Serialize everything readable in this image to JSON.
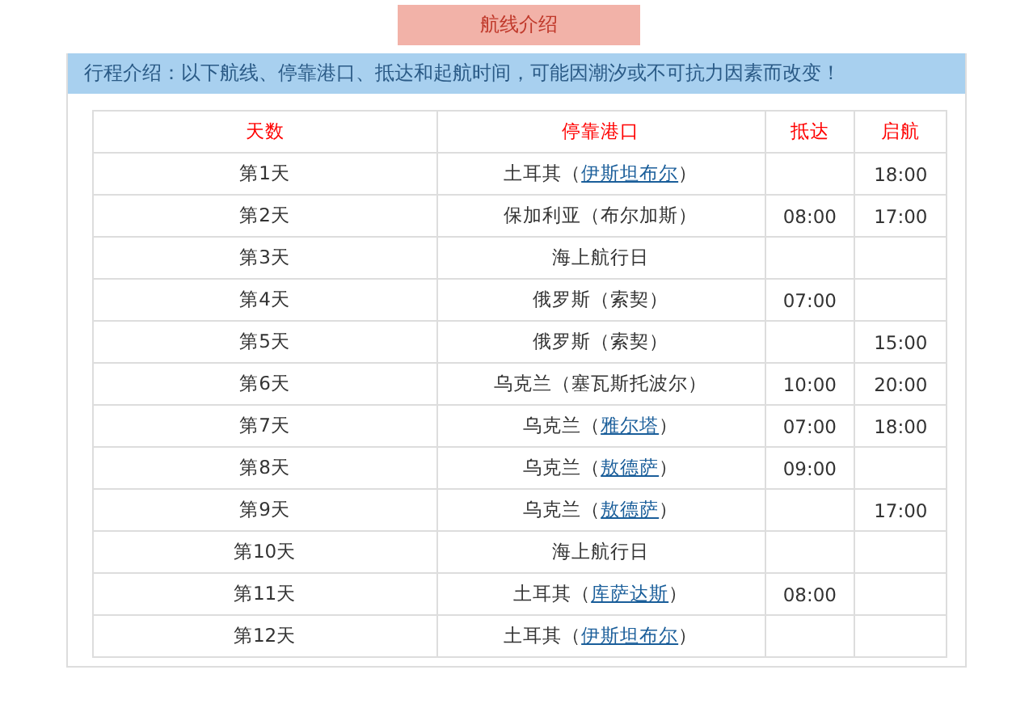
{
  "title": "航线介绍",
  "notice": "行程介绍：以下航线、停靠港口、抵达和起航时间，可能因潮汐或不可抗力因素而改变！",
  "table": {
    "columns": [
      "天数",
      "停靠港口",
      "抵达",
      "启航"
    ],
    "rows": [
      {
        "day": "第1天",
        "port": [
          {
            "text": "土耳其（"
          },
          {
            "text": "伊斯坦布尔",
            "link": true
          },
          {
            "text": "）"
          }
        ],
        "arrive": "",
        "depart": "18:00"
      },
      {
        "day": "第2天",
        "port": [
          {
            "text": "保加利亚（布尔加斯）"
          }
        ],
        "arrive": "08:00",
        "depart": "17:00"
      },
      {
        "day": "第3天",
        "port": [
          {
            "text": "海上航行日"
          }
        ],
        "arrive": "",
        "depart": ""
      },
      {
        "day": "第4天",
        "port": [
          {
            "text": "俄罗斯（索契）"
          }
        ],
        "arrive": "07:00",
        "depart": ""
      },
      {
        "day": "第5天",
        "port": [
          {
            "text": "俄罗斯（索契）"
          }
        ],
        "arrive": "",
        "depart": "15:00"
      },
      {
        "day": "第6天",
        "port": [
          {
            "text": "乌克兰（塞瓦斯托波尔）"
          }
        ],
        "arrive": "10:00",
        "depart": "20:00"
      },
      {
        "day": "第7天",
        "port": [
          {
            "text": "乌克兰（"
          },
          {
            "text": "雅尔塔",
            "link": true
          },
          {
            "text": "）"
          }
        ],
        "arrive": "07:00",
        "depart": "18:00"
      },
      {
        "day": "第8天",
        "port": [
          {
            "text": "乌克兰（"
          },
          {
            "text": "敖德萨",
            "link": true
          },
          {
            "text": "）"
          }
        ],
        "arrive": "09:00",
        "depart": ""
      },
      {
        "day": "第9天",
        "port": [
          {
            "text": "乌克兰（"
          },
          {
            "text": "敖德萨",
            "link": true
          },
          {
            "text": "）"
          }
        ],
        "arrive": "",
        "depart": "17:00"
      },
      {
        "day": "第10天",
        "port": [
          {
            "text": "海上航行日"
          }
        ],
        "arrive": "",
        "depart": ""
      },
      {
        "day": "第11天",
        "port": [
          {
            "text": "土耳其（"
          },
          {
            "text": "库萨达斯",
            "link": true
          },
          {
            "text": "）"
          }
        ],
        "arrive": "08:00",
        "depart": ""
      },
      {
        "day": "第12天",
        "port": [
          {
            "text": "土耳其（"
          },
          {
            "text": "伊斯坦布尔",
            "link": true
          },
          {
            "text": "）"
          }
        ],
        "arrive": "",
        "depart": ""
      }
    ]
  }
}
